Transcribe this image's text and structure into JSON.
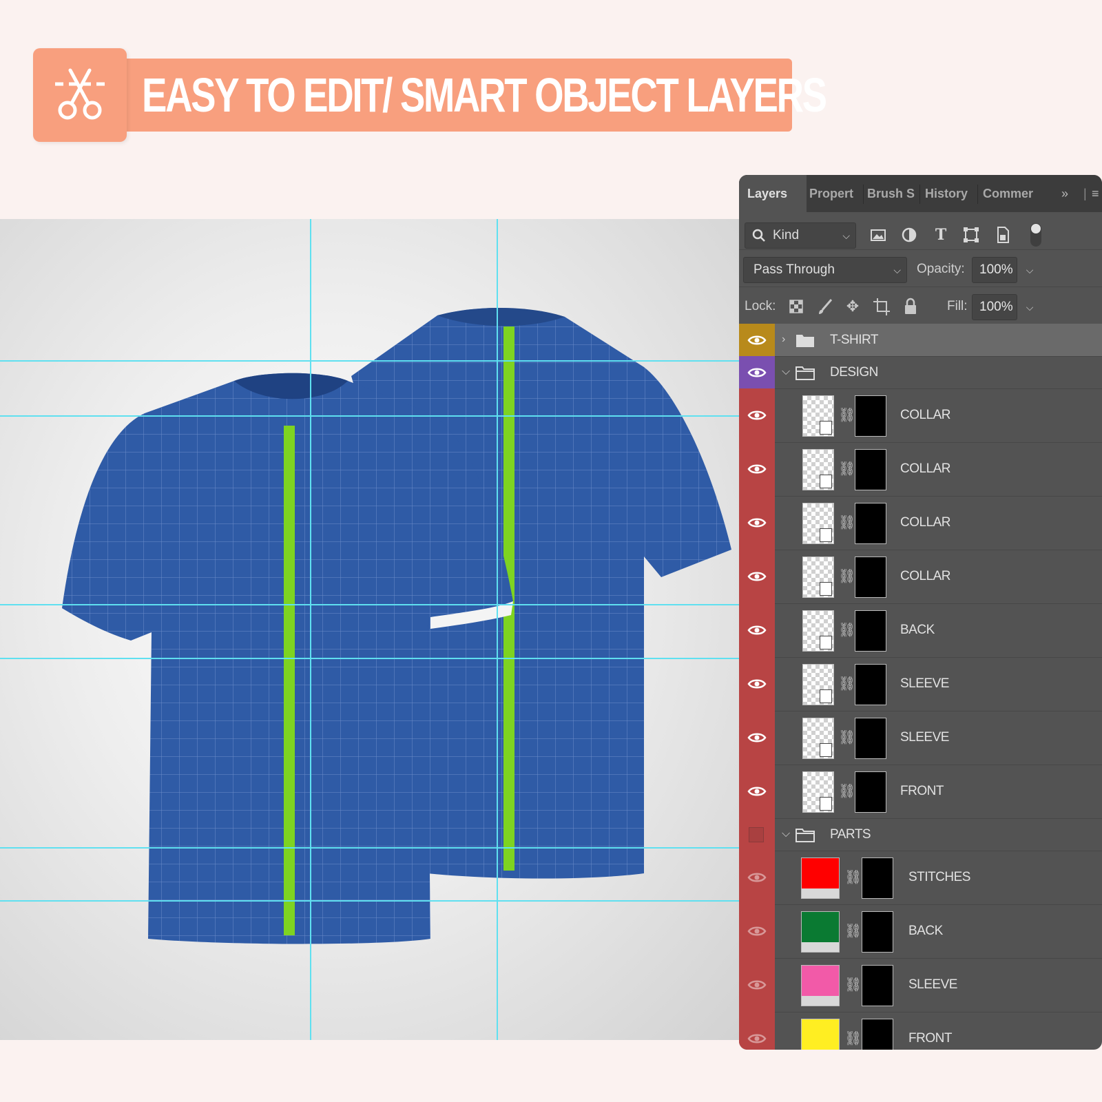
{
  "banner": {
    "title": "EASY TO EDIT/ SMART OBJECT LAYERS",
    "icon": "scissors-icon",
    "color": "#f89f7e"
  },
  "canvas": {
    "shirt_color": "#2f5ba6",
    "stripe_color": "#7ed321",
    "guide_color": "#5fe0f0"
  },
  "panel": {
    "tabs": [
      "Layers",
      "Propert",
      "Brush S",
      "History",
      "Commer"
    ],
    "active_tab": "Layers",
    "more_icon": "double-chevron-right-icon",
    "menu_icon": "hamburger-menu-icon",
    "filter": {
      "kind_label": "Kind",
      "icons": [
        "image-filter-icon",
        "adjustment-filter-icon",
        "type-filter-icon",
        "shape-filter-icon",
        "smart-object-filter-icon"
      ]
    },
    "blend_mode": "Pass Through",
    "opacity_label": "Opacity:",
    "opacity_value": "100%",
    "lock_label": "Lock:",
    "lock_icons": [
      "lock-transparent-icon",
      "lock-brush-icon",
      "lock-move-icon",
      "lock-artboard-icon",
      "lock-all-icon"
    ],
    "fill_label": "Fill:",
    "fill_value": "100%"
  },
  "layers": [
    {
      "name": "T-SHIRT",
      "type": "group",
      "expanded": false,
      "color": "#b88a1b",
      "selected": true,
      "visible": true
    },
    {
      "name": "DESIGN",
      "type": "group",
      "expanded": true,
      "color": "#7a4fb0",
      "visible": true
    },
    {
      "name": "COLLAR",
      "type": "smart",
      "color": "#b84444",
      "visible": true
    },
    {
      "name": "COLLAR",
      "type": "smart",
      "color": "#b84444",
      "visible": true
    },
    {
      "name": "COLLAR",
      "type": "smart",
      "color": "#b84444",
      "visible": true
    },
    {
      "name": "COLLAR",
      "type": "smart",
      "color": "#b84444",
      "visible": true
    },
    {
      "name": "BACK",
      "type": "smart",
      "color": "#b84444",
      "visible": true
    },
    {
      "name": "SLEEVE",
      "type": "smart",
      "color": "#b84444",
      "visible": true
    },
    {
      "name": "SLEEVE",
      "type": "smart",
      "color": "#b84444",
      "visible": true
    },
    {
      "name": "FRONT",
      "type": "smart",
      "color": "#b84444",
      "visible": true
    },
    {
      "name": "PARTS",
      "type": "group",
      "expanded": true,
      "color": "#b84444",
      "visible": false
    },
    {
      "name": "STITCHES",
      "type": "fill",
      "fill_color": "#ff0000",
      "color": "#b84444",
      "visible": false
    },
    {
      "name": "BACK",
      "type": "fill",
      "fill_color": "#0a7a32",
      "color": "#b84444",
      "visible": false
    },
    {
      "name": "SLEEVE",
      "type": "fill",
      "fill_color": "#f25aa8",
      "color": "#b84444",
      "visible": false
    },
    {
      "name": "FRONT",
      "type": "fill",
      "fill_color": "#ffee22",
      "color": "#b84444",
      "visible": false
    }
  ]
}
